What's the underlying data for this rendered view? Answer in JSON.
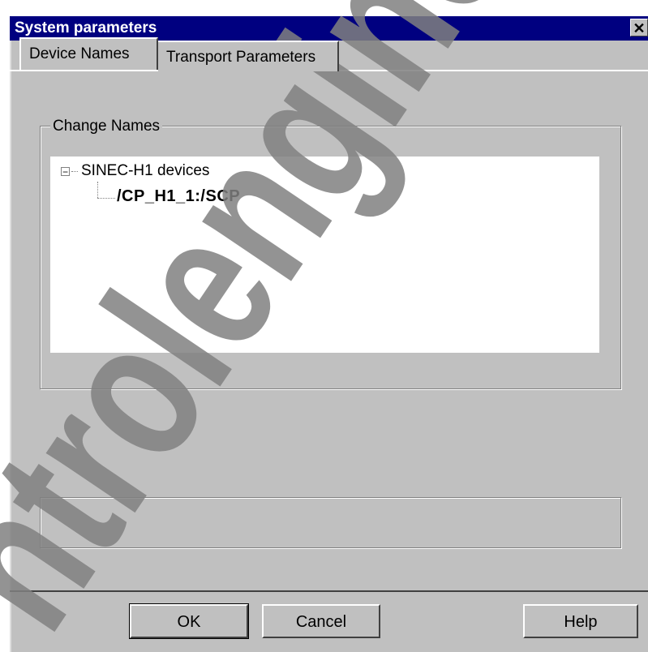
{
  "window": {
    "title": "System parameters",
    "close_glyph": "✕"
  },
  "tabs": [
    {
      "label": "Device Names",
      "active": true
    },
    {
      "label": "Transport Parameters",
      "active": false
    }
  ],
  "change_names": {
    "group_label": "Change Names",
    "tree": {
      "root": {
        "label": "SINEC-H1 devices",
        "expanded": true,
        "expander_glyph": "−"
      },
      "children": [
        {
          "label": "/CP_H1_1:/SCP"
        }
      ]
    }
  },
  "buttons": {
    "ok": "OK",
    "cancel": "Cancel",
    "help": "Help"
  },
  "colors": {
    "titlebar": "#000080",
    "dialog_face": "#c0c0c0",
    "watermark": "#808080"
  },
  "watermark": {
    "text": "ntrolengineer"
  }
}
